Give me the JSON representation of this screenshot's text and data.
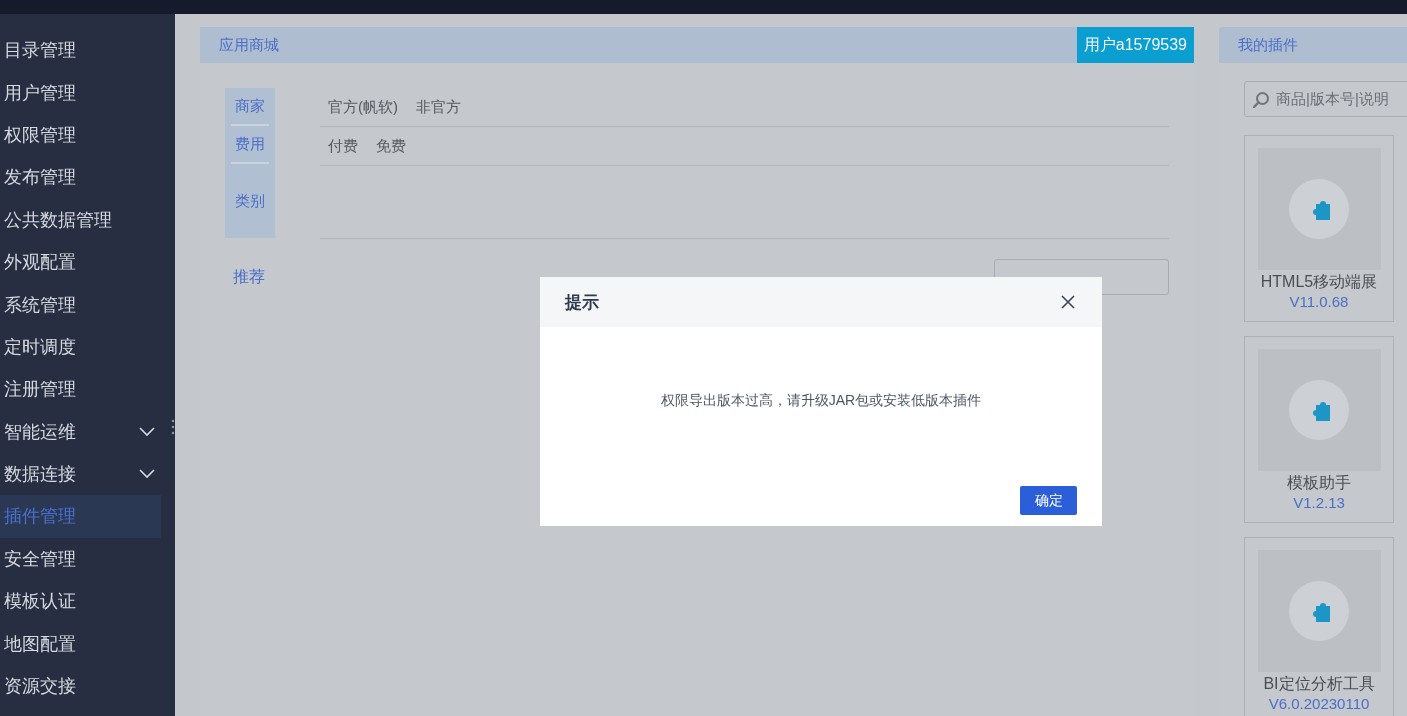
{
  "sidebar": {
    "items": [
      {
        "label": "目录管理",
        "kind": "link",
        "selected": false
      },
      {
        "label": "用户管理",
        "kind": "link",
        "selected": false
      },
      {
        "label": "权限管理",
        "kind": "link",
        "selected": false
      },
      {
        "label": "发布管理",
        "kind": "link",
        "selected": false
      },
      {
        "label": "公共数据管理",
        "kind": "link",
        "selected": false
      },
      {
        "label": "外观配置",
        "kind": "link",
        "selected": false
      },
      {
        "label": "系统管理",
        "kind": "link",
        "selected": false
      },
      {
        "label": "定时调度",
        "kind": "link",
        "selected": false
      },
      {
        "label": "注册管理",
        "kind": "link",
        "selected": false
      },
      {
        "label": "智能运维",
        "kind": "group",
        "selected": false
      },
      {
        "label": "数据连接",
        "kind": "group",
        "selected": false
      },
      {
        "label": "插件管理",
        "kind": "link",
        "selected": true
      },
      {
        "label": "安全管理",
        "kind": "link",
        "selected": false
      },
      {
        "label": "模板认证",
        "kind": "link",
        "selected": false
      },
      {
        "label": "地图配置",
        "kind": "link",
        "selected": false
      },
      {
        "label": "资源交接",
        "kind": "link",
        "selected": false
      }
    ]
  },
  "store": {
    "title": "应用商城",
    "user": "用户a1579539",
    "filters": [
      {
        "label": "商家",
        "options": [
          "官方(帆软)",
          "非官方"
        ]
      },
      {
        "label": "费用",
        "options": [
          "付费",
          "免费"
        ]
      },
      {
        "label": "类别"
      }
    ],
    "recommend": "推荐"
  },
  "my_plugins": {
    "title": "我的插件",
    "search": {
      "placeholder": "商品|版本号|说明"
    },
    "cards": [
      {
        "name": "HTML5移动端展",
        "version": "V11.0.68"
      },
      {
        "name": "模板助手",
        "version": "V1.2.13"
      },
      {
        "name": "BI定位分析工具",
        "version": "V6.0.20230110"
      }
    ]
  },
  "dialog": {
    "title": "提示",
    "message": "权限导出版本过高，请升级JAR包或安装低版本插件",
    "confirm": "确定"
  }
}
